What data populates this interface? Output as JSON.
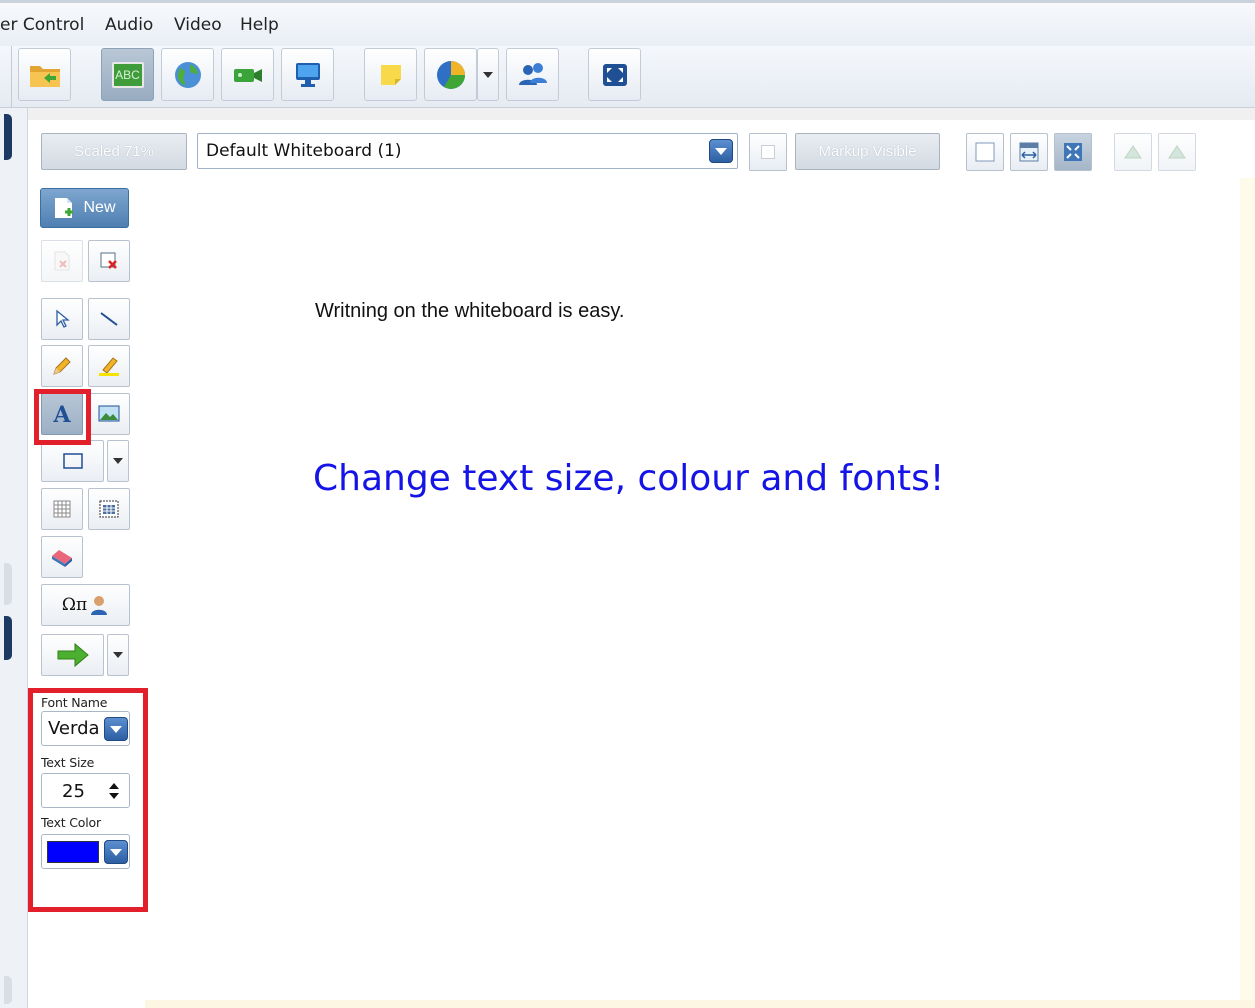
{
  "menu": {
    "items": [
      "er Control",
      "Audio",
      "Video",
      "Help"
    ]
  },
  "toolbar": {
    "buttons": [
      {
        "name": "open-folder-icon"
      },
      {
        "name": "whiteboard-abc-icon",
        "label": "ABC",
        "active": true
      },
      {
        "name": "globe-web-icon"
      },
      {
        "name": "video-camera-icon"
      },
      {
        "name": "monitor-screen-share-icon"
      },
      {
        "name": "sticky-note-icon"
      },
      {
        "name": "pie-chart-poll-icon"
      },
      {
        "name": "users-group-icon"
      },
      {
        "name": "fullscreen-icon"
      }
    ]
  },
  "whiteboard_header": {
    "scale_label": "Scaled 71%",
    "board_name": "Default Whiteboard (1)",
    "markup_label": "Markup Visible"
  },
  "palette": {
    "new_label": "New",
    "special_chars_label": "Ωπ",
    "active_tool": "text"
  },
  "properties": {
    "font_name_label": "Font Name",
    "font_name_value": "Verda",
    "text_size_label": "Text Size",
    "text_size_value": "25",
    "text_color_label": "Text Color",
    "text_color_value": "#0000ff"
  },
  "whiteboard": {
    "line1": "Writning on the whiteboard is easy.",
    "line2": "Change text size, colour and fonts!",
    "line2_color": "#1414e6"
  },
  "colors": {
    "highlight": "#e2202b",
    "accent_blue": "#2d5fa3"
  }
}
